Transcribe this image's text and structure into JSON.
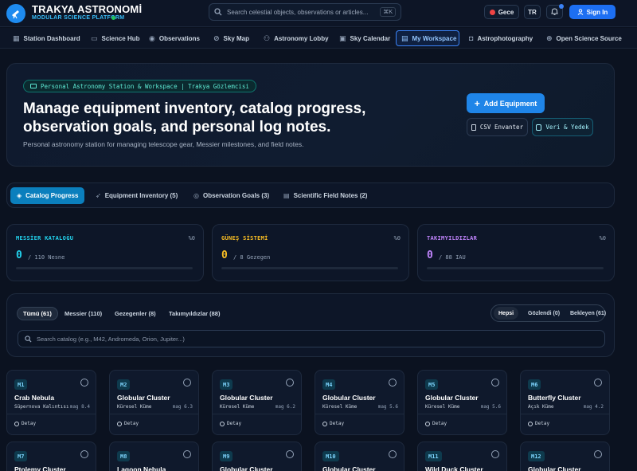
{
  "header": {
    "brand_title": "TRAKYA ASTRONOMİ",
    "brand_subtitle": "MODULAR SCIENCE PLATFORM",
    "search_placeholder": "Search celestial objects, observations or articles...",
    "search_shortcut": "⌘K",
    "theme_label": "Gece",
    "lang_label": "TR",
    "signin_label": "Sign In"
  },
  "nav": {
    "items": [
      {
        "label": "Station Dashboard",
        "icon": "dashboard-icon"
      },
      {
        "label": "Science Hub",
        "icon": "book-icon"
      },
      {
        "label": "Observations",
        "icon": "eye-icon"
      },
      {
        "label": "Sky Map",
        "icon": "compass-icon"
      },
      {
        "label": "Astronomy Lobby",
        "icon": "users-icon"
      },
      {
        "label": "Sky Calendar",
        "icon": "calendar-icon"
      },
      {
        "label": "My Workspace",
        "icon": "workspace-icon",
        "active": true
      },
      {
        "label": "Astrophotography",
        "icon": "camera-icon"
      },
      {
        "label": "Open Science Source",
        "icon": "globe-icon"
      }
    ]
  },
  "hero": {
    "chip": "Personal Astronomy Station & Workspace | Trakya Gözlemcisi",
    "title": "Manage equipment inventory, catalog progress, observation goals, and personal log notes.",
    "description": "Personal astronomy station for managing telescope gear, Messier milestones, and field notes.",
    "add_button": "Add Equipment",
    "csv_button": "CSV Envanter",
    "data_button": "Veri & Yedek"
  },
  "tabs": [
    {
      "label": "Catalog Progress",
      "active": true
    },
    {
      "label": "Equipment Inventory (5)"
    },
    {
      "label": "Observation Goals (3)"
    },
    {
      "label": "Scientific Field Notes (2)"
    }
  ],
  "stats": [
    {
      "label": "MESSİER KATALOĞU",
      "pct": "%0",
      "value": "0",
      "sub": "/ 110 Nesne",
      "progress": 0,
      "color": "#22d3ee"
    },
    {
      "label": "GÜNEŞ SİSTEMİ",
      "pct": "%0",
      "value": "0",
      "sub": "/ 8 Gezegen",
      "progress": 0,
      "color": "#fbbf24"
    },
    {
      "label": "TAKIMYILDIZLAR",
      "pct": "%0",
      "value": "0",
      "sub": "/ 88 IAU",
      "progress": 0,
      "color": "#c084fc"
    }
  ],
  "catalog": {
    "filters": [
      {
        "label": "Tümü (61)",
        "active": true
      },
      {
        "label": "Messier (110)"
      },
      {
        "label": "Gezegenler (8)"
      },
      {
        "label": "Takımyıldızlar (88)"
      }
    ],
    "status_filters": [
      {
        "label": "Hepsi",
        "active": true
      },
      {
        "label": "Gözlendi (0)"
      },
      {
        "label": "Bekleyen (61)"
      }
    ],
    "search_placeholder": "Search catalog (e.g., M42, Andromeda, Orion, Jupiter...)"
  },
  "objects": [
    {
      "id": "M1",
      "name": "Crab Nebula",
      "type": "Süpernova Kalıntısı",
      "mag": "mag 8.4"
    },
    {
      "id": "M2",
      "name": "Globular Cluster",
      "type": "Küresel Küme",
      "mag": "mag 6.3"
    },
    {
      "id": "M3",
      "name": "Globular Cluster",
      "type": "Küresel Küme",
      "mag": "mag 6.2"
    },
    {
      "id": "M4",
      "name": "Globular Cluster",
      "type": "Küresel Küme",
      "mag": "mag 5.6"
    },
    {
      "id": "M5",
      "name": "Globular Cluster",
      "type": "Küresel Küme",
      "mag": "mag 5.6"
    },
    {
      "id": "M6",
      "name": "Butterfly Cluster",
      "type": "Açık Küme",
      "mag": "mag 4.2"
    },
    {
      "id": "M7",
      "name": "Ptolemy Cluster",
      "type": "",
      "mag": ""
    },
    {
      "id": "M8",
      "name": "Lagoon Nebula",
      "type": "",
      "mag": ""
    },
    {
      "id": "M9",
      "name": "Globular Cluster",
      "type": "",
      "mag": ""
    },
    {
      "id": "M10",
      "name": "Globular Cluster",
      "type": "",
      "mag": ""
    },
    {
      "id": "M11",
      "name": "Wild Duck Cluster",
      "type": "",
      "mag": ""
    },
    {
      "id": "M12",
      "name": "Globular Cluster",
      "type": "",
      "mag": ""
    }
  ],
  "object_detail_label": "Detay"
}
